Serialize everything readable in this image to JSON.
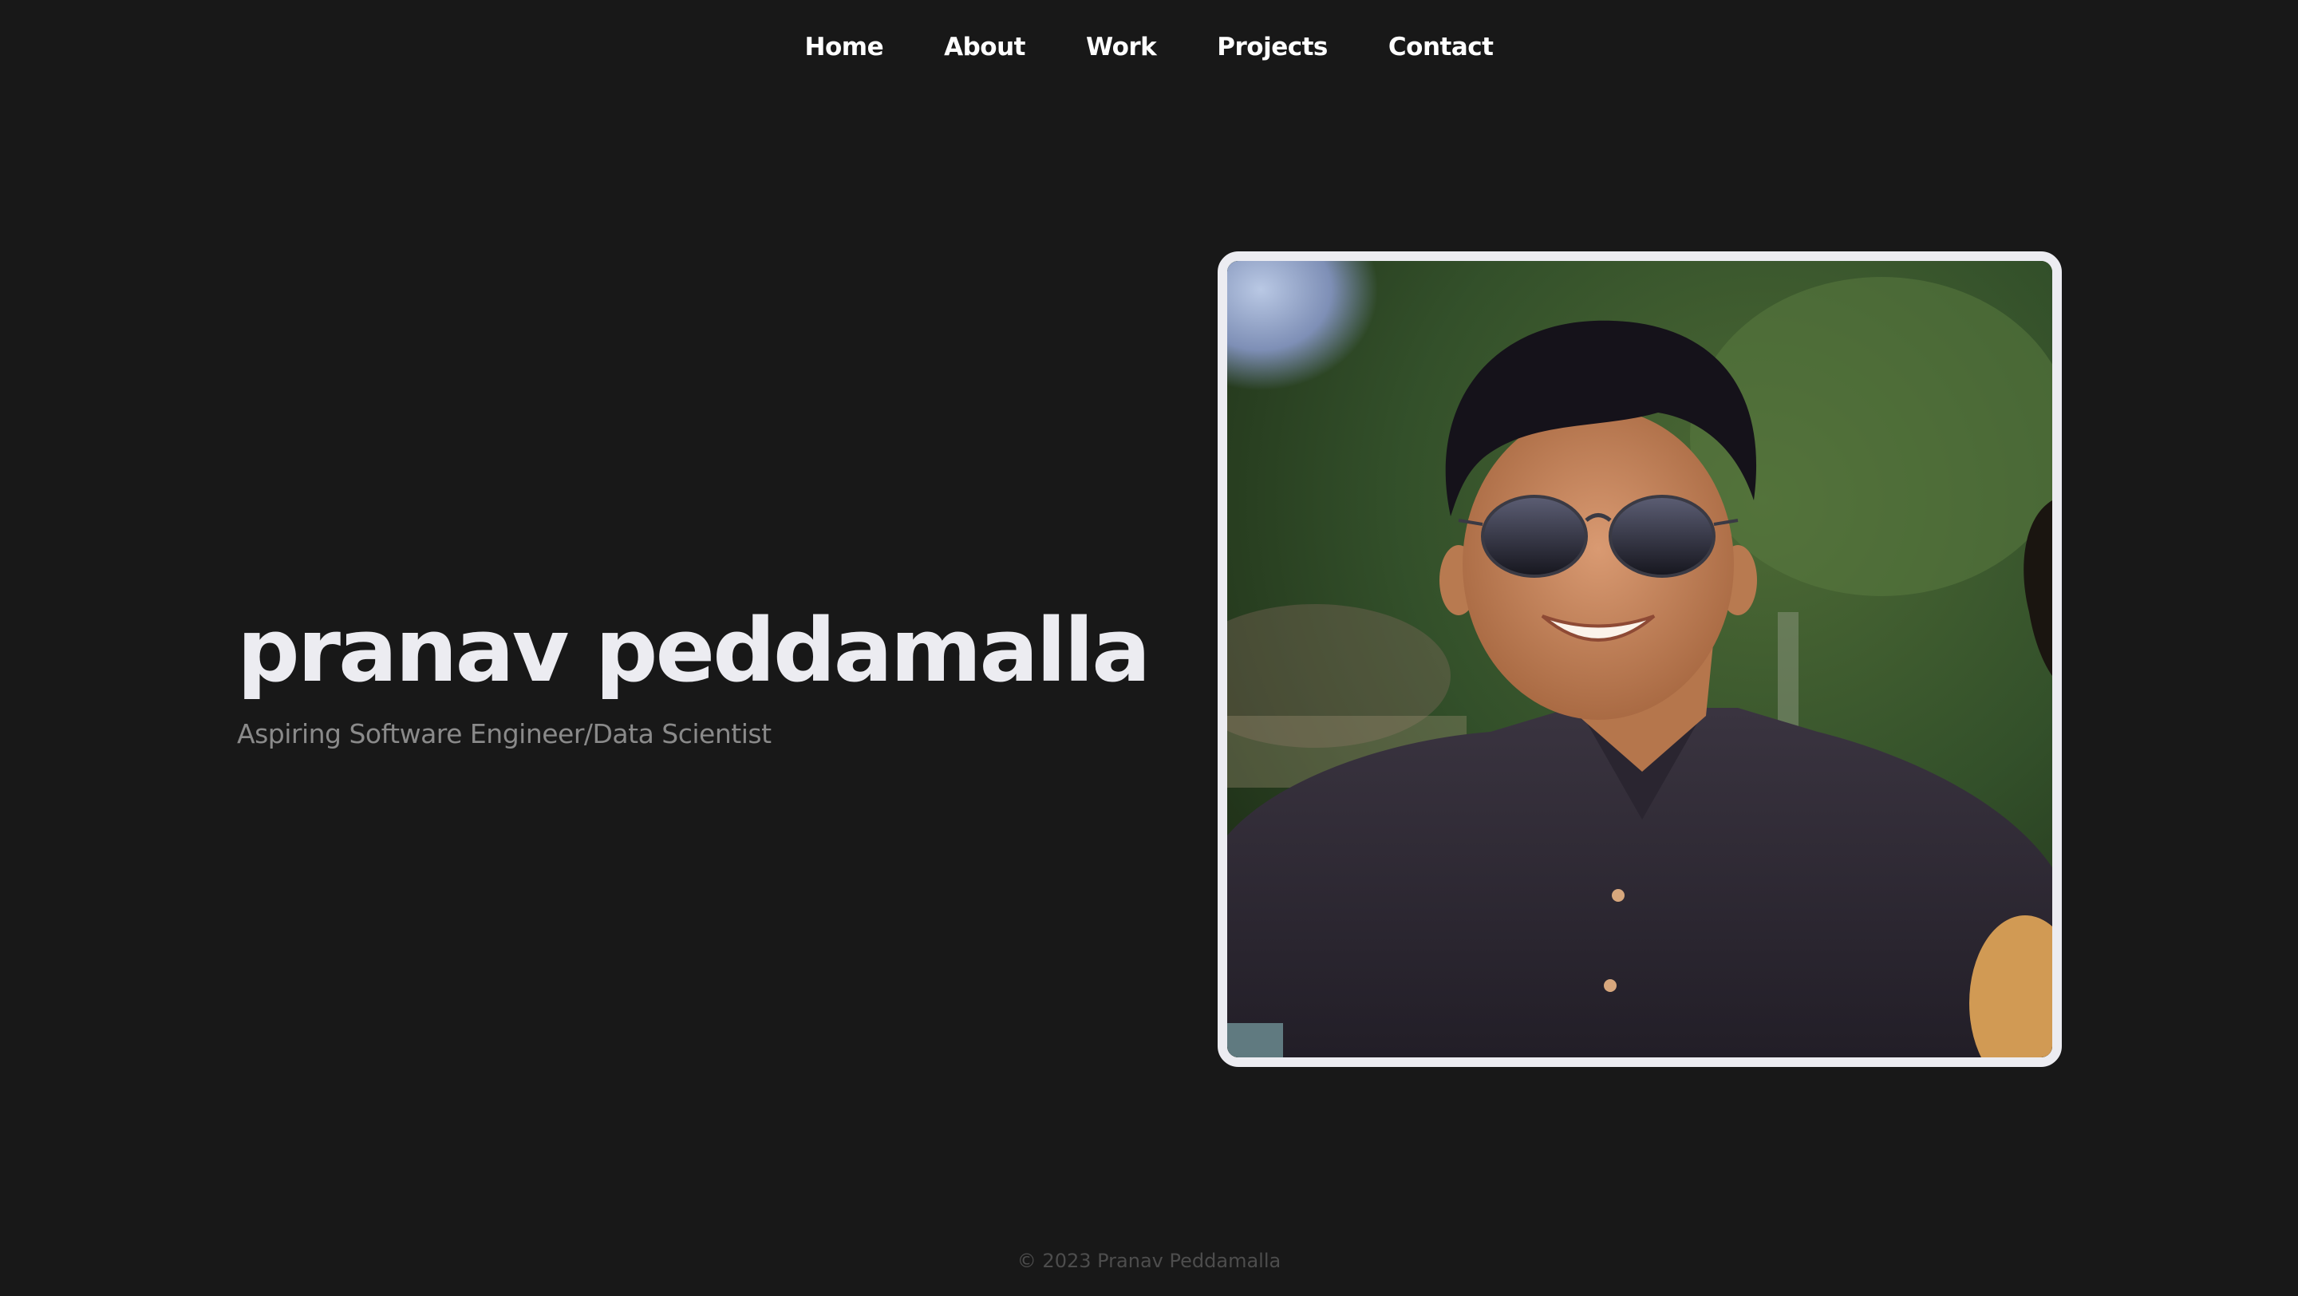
{
  "nav": {
    "items": [
      {
        "label": "Home"
      },
      {
        "label": "About"
      },
      {
        "label": "Work"
      },
      {
        "label": "Projects"
      },
      {
        "label": "Contact"
      }
    ]
  },
  "hero": {
    "name": "pranav peddamalla",
    "subtitle": "Aspiring Software Engineer/Data Scientist",
    "photo_alt": "portrait-photo"
  },
  "footer": {
    "copyright": "© 2023 Pranav Peddamalla"
  },
  "colors": {
    "background": "#181818",
    "nav_text": "#ffffff",
    "name_text": "#ececf1",
    "subtitle_text": "#8a8a8a",
    "frame_border": "#ececf1",
    "footer_text": "#4d4d4d"
  }
}
